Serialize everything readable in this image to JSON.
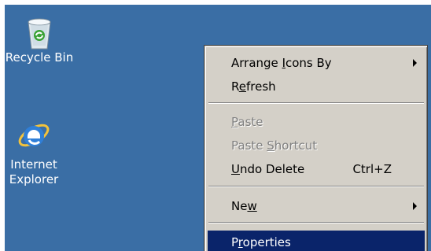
{
  "desktop": {
    "background": "#3a6ea5",
    "icons": [
      {
        "name": "recycle-bin",
        "label": "Recycle Bin",
        "icon": "recycle-bin-icon"
      },
      {
        "name": "internet-explorer",
        "label_line1": "Internet",
        "label_line2": "Explorer",
        "icon": "internet-explorer-icon"
      }
    ]
  },
  "context_menu": {
    "items": [
      {
        "pre": "Arrange ",
        "ul": "I",
        "post": "cons By",
        "submenu": true
      },
      {
        "pre": "R",
        "ul": "e",
        "post": "fresh"
      },
      {
        "pre": "",
        "ul": "P",
        "post": "aste",
        "disabled": true
      },
      {
        "pre": "Paste ",
        "ul": "S",
        "post": "hortcut",
        "disabled": true
      },
      {
        "pre": "",
        "ul": "U",
        "post": "ndo Delete",
        "shortcut": "Ctrl+Z"
      },
      {
        "pre": "Ne",
        "ul": "w",
        "post": "",
        "submenu": true
      },
      {
        "pre": "P",
        "ul": "r",
        "post": "operties",
        "selected": true
      }
    ],
    "highlight_color": "#0a246a"
  }
}
